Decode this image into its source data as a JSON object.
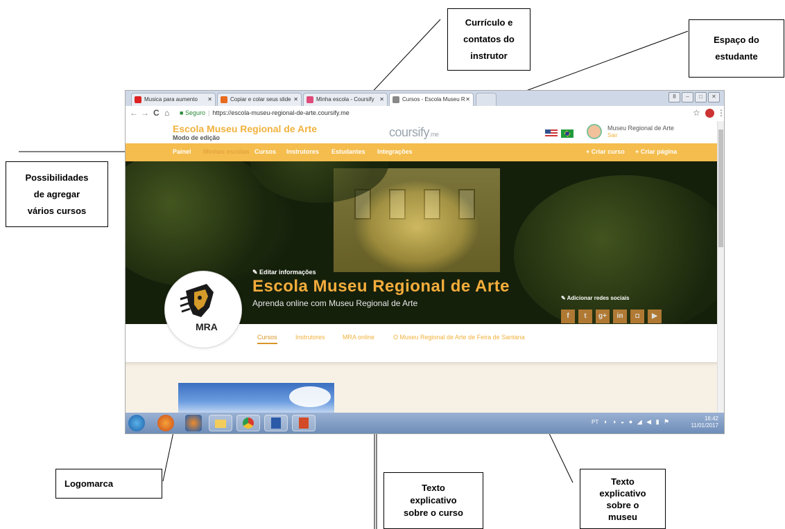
{
  "annotations": {
    "curriculo": [
      "Currículo e",
      "contatos do",
      "instrutor"
    ],
    "espaco": [
      "Espaço do",
      "estudante"
    ],
    "possibilidades": [
      "Possibilidades",
      "de agregar",
      "vários cursos"
    ],
    "logomarca": [
      "Logomarca"
    ],
    "texto_curso": [
      "Texto",
      "explicativo",
      "sobre o curso"
    ],
    "texto_museu": [
      "Texto",
      "explicativo",
      "sobre o",
      "museu"
    ]
  },
  "browser": {
    "tabs": [
      {
        "label": "Musica para aumento",
        "favicon_color": "#d22"
      },
      {
        "label": "Copiar e colar seus slide",
        "favicon_color": "#e86a1c"
      },
      {
        "label": "Minha escola - Coursify",
        "favicon_color": "#e04a7a"
      },
      {
        "label": "Cursos - Escola Museu R",
        "favicon_color": "#888888"
      }
    ],
    "back": "←",
    "forward": "→",
    "reload": "C",
    "home": "⌂",
    "secure_label": "Seguro",
    "url": "https://escola-museu-regional-de-arte.coursify.me",
    "star": "☆"
  },
  "site": {
    "school_name": "Escola Museu Regional de Arte",
    "mode": "Modo de edição",
    "brand": "coursify",
    "brand_suffix": ".me",
    "user_name": "Museu Regional de Arte",
    "logout": "Sair"
  },
  "menu": {
    "items": [
      "Painel",
      "Minhas escolas",
      "Cursos",
      "Instrutores",
      "Estudantes",
      "Integrações"
    ],
    "create_course": "+ Criar curso",
    "create_page": "+ Criar página"
  },
  "hero": {
    "edit_info": "Editar informações",
    "title": "Escola Museu Regional de Arte",
    "subtitle": "Aprenda online com Museu Regional de Arte",
    "add_social": "Adicionar redes sociais",
    "social_icons": [
      "f",
      "t",
      "g+",
      "in",
      "◘",
      "▶"
    ]
  },
  "logo": {
    "text": "MRA"
  },
  "content_tabs": [
    "Cursos",
    "Instrutores",
    "MRA online",
    "O Museu Regional de Arte de Feira de Santana"
  ],
  "taskbar": {
    "icons": [
      "start-orb-icon",
      "firefox-icon",
      "media-player-icon",
      "folder-icon",
      "chrome-icon",
      "word-icon",
      "powerpoint-icon"
    ],
    "language": "PT",
    "time": "16:42",
    "date": "11/01/2017"
  },
  "colors": {
    "accent_orange": "#f5bd4d",
    "title_orange": "#f5ad3c"
  }
}
